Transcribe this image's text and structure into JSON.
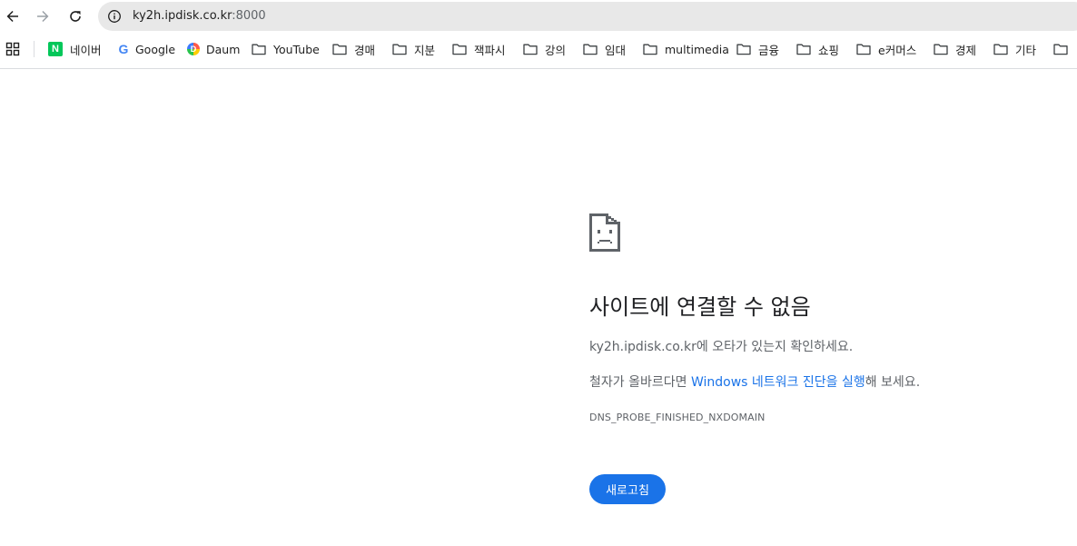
{
  "toolbar": {
    "back_icon": "arrow-left-icon",
    "forward_icon": "arrow-right-icon",
    "reload_icon": "reload-icon",
    "info_icon": "info-icon",
    "url_host": "ky2h.ipdisk.co.kr",
    "url_port": ":8000"
  },
  "bookmarks": {
    "apps_icon": "apps-grid-icon",
    "items": [
      {
        "label": "네이버",
        "icon": "naver-icon"
      },
      {
        "label": "Google",
        "icon": "google-icon"
      },
      {
        "label": "Daum",
        "icon": "daum-icon"
      },
      {
        "label": "YouTube",
        "icon": "folder-icon"
      },
      {
        "label": "경매",
        "icon": "folder-icon"
      },
      {
        "label": "지분",
        "icon": "folder-icon"
      },
      {
        "label": "잭파시",
        "icon": "folder-icon"
      },
      {
        "label": "강의",
        "icon": "folder-icon"
      },
      {
        "label": "임대",
        "icon": "folder-icon"
      },
      {
        "label": "multimedia",
        "icon": "folder-icon"
      },
      {
        "label": "금융",
        "icon": "folder-icon"
      },
      {
        "label": "쇼핑",
        "icon": "folder-icon"
      },
      {
        "label": "e커머스",
        "icon": "folder-icon"
      },
      {
        "label": "경제",
        "icon": "folder-icon"
      },
      {
        "label": "기타",
        "icon": "folder-icon"
      }
    ]
  },
  "error": {
    "icon": "sad-page-icon",
    "title": "사이트에 연결할 수 없음",
    "host": "ky2h.ipdisk.co.kr",
    "line1_suffix": "에 오타가 있는지 확인하세요.",
    "line2_prefix": "철자가 올바르다면 ",
    "line2_link": "Windows 네트워크 진단을 실행",
    "line2_suffix": "해 보세요.",
    "code": "DNS_PROBE_FINISHED_NXDOMAIN",
    "reload_label": "새로고침"
  },
  "colors": {
    "accent": "#1a73e8",
    "omnibox_bg": "#e8e8e8",
    "secondary_text": "#5f6368",
    "naver_green": "#03c75a"
  }
}
